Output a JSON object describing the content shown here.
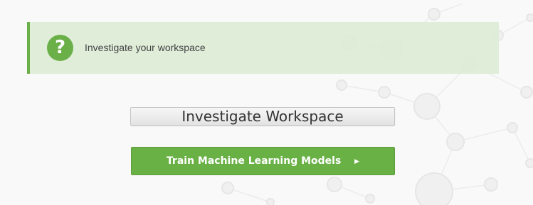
{
  "alert": {
    "icon": "question-circle-icon",
    "icon_glyph": "?",
    "message": "Investigate your workspace"
  },
  "buttons": {
    "investigate_label": "Investigate Workspace",
    "train_label": "Train Machine Learning Models",
    "train_icon": "caret-right-icon",
    "train_icon_glyph": "▶"
  },
  "colors": {
    "accent_green": "#6aaf48",
    "alert_bg": "#ddebd6",
    "page_bg": "#f9f9f9"
  }
}
